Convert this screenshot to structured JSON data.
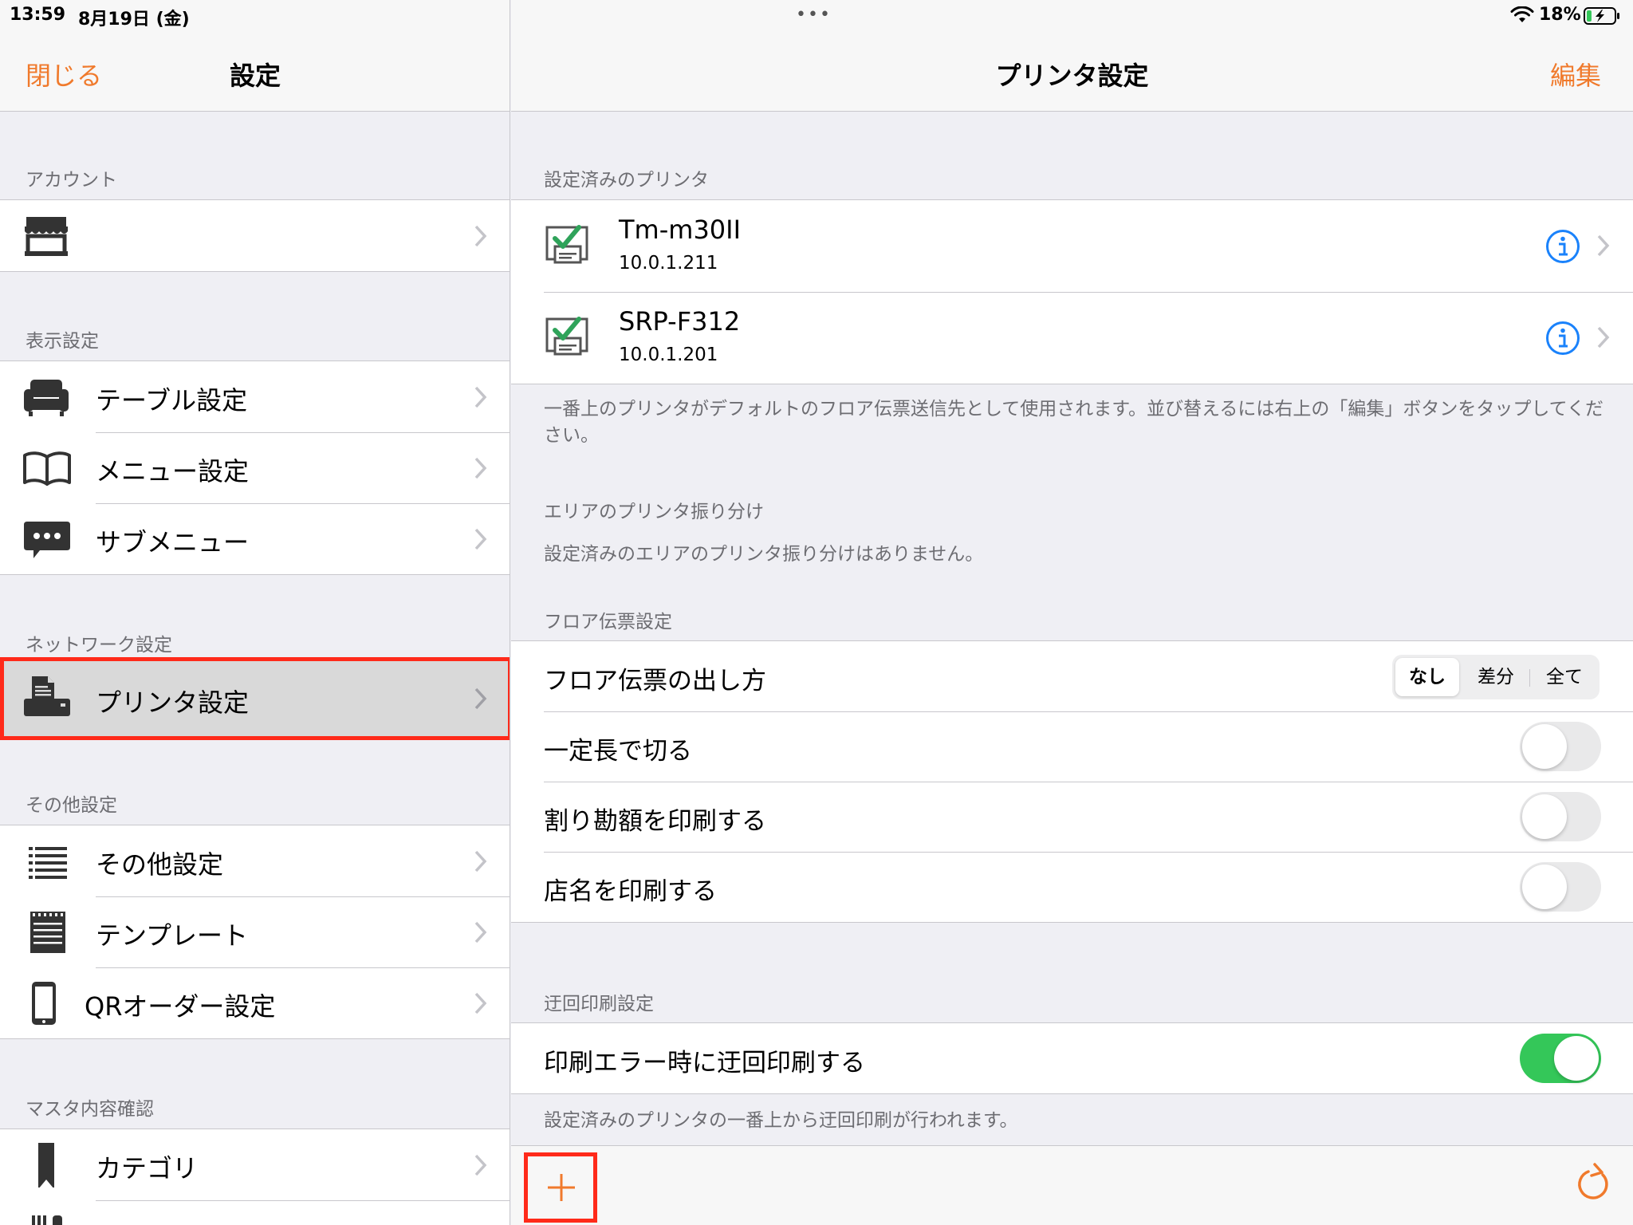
{
  "status_bar": {
    "time": "13:59",
    "date": "8月19日 (金)",
    "battery_percent": "18%",
    "battery_level": 0.18,
    "charging": true
  },
  "colors": {
    "accent": "#f07a2c",
    "info": "#1a82fb",
    "toggle_on": "#34c759",
    "highlight": "#ff2a1a",
    "check": "#2fa35a"
  },
  "sidebar": {
    "close_label": "閉じる",
    "title": "設定",
    "sections": [
      {
        "header": "アカウント",
        "items": [
          {
            "icon": "store-icon",
            "label": ""
          }
        ]
      },
      {
        "header": "表示設定",
        "items": [
          {
            "icon": "sofa-icon",
            "label": "テーブル設定"
          },
          {
            "icon": "book-icon",
            "label": "メニュー設定"
          },
          {
            "icon": "chat-bubble-icon",
            "label": "サブメニュー"
          }
        ]
      },
      {
        "header": "ネットワーク設定",
        "items": [
          {
            "icon": "printer-icon",
            "label": "プリンタ設定",
            "selected": true
          }
        ]
      },
      {
        "header": "その他設定",
        "items": [
          {
            "icon": "list-icon",
            "label": "その他設定"
          },
          {
            "icon": "notepad-icon",
            "label": "テンプレート"
          },
          {
            "icon": "phone-icon",
            "label": "QRオーダー設定"
          }
        ]
      },
      {
        "header": "マスタ内容確認",
        "items": [
          {
            "icon": "bookmark-icon",
            "label": "カテゴリ"
          }
        ]
      }
    ]
  },
  "main": {
    "title": "プリンタ設定",
    "edit_label": "編集",
    "configured_header": "設定済みのプリンタ",
    "printers": [
      {
        "name": "Tm-m30II",
        "ip": "10.0.1.211"
      },
      {
        "name": "SRP-F312",
        "ip": "10.0.1.201"
      }
    ],
    "printers_footnote": "一番上のプリンタがデフォルトのフロア伝票送信先として使用されます。並び替えるには右上の「編集」ボタンをタップしてください。",
    "area_header": "エリアのプリンタ振り分け",
    "area_empty": "設定済みのエリアのプリンタ振り分けはありません。",
    "floor_header": "フロア伝票設定",
    "floor_rows": {
      "output_method": {
        "label": "フロア伝票の出し方",
        "options": [
          "なし",
          "差分",
          "全て"
        ],
        "selected": "なし"
      },
      "cut_fixed": {
        "label": "一定長で切る",
        "on": false
      },
      "print_split": {
        "label": "割り勘額を印刷する",
        "on": false
      },
      "print_store": {
        "label": "店名を印刷する",
        "on": false
      }
    },
    "detour_header": "迂回印刷設定",
    "detour_row": {
      "label": "印刷エラー時に迂回印刷する",
      "on": true
    },
    "detour_footnote": "設定済みのプリンタの一番上から迂回印刷が行われます。"
  }
}
